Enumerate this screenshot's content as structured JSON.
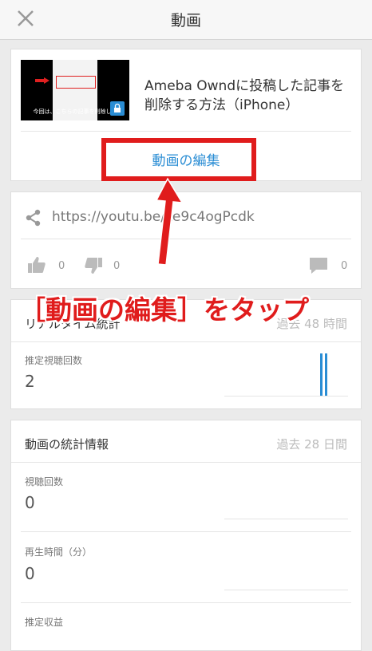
{
  "header": {
    "title": "動画",
    "close_icon": "close-icon"
  },
  "video": {
    "title": "Ameba Owndに投稿した記事を削除する方法（iPhone）",
    "thumbnail_caption": "今回は、こちらの記事を削除しま",
    "edit_label": "動画の編集"
  },
  "share": {
    "url": "https://youtu.be/ze9c4ogPcdk",
    "likes": "0",
    "dislikes": "0",
    "comments": "0"
  },
  "realtime": {
    "title": "リアルタイム統計",
    "period": "過去 48 時間",
    "metric_label": "推定視聴回数",
    "metric_value": "2"
  },
  "stats": {
    "title": "動画の統計情報",
    "period": "過去 28 日間",
    "views_label": "視聴回数",
    "views_value": "0",
    "watch_label": "再生時間（分）",
    "watch_value": "0",
    "revenue_label": "推定収益"
  },
  "annotation": {
    "text": "［動画の編集］をタップ",
    "color": "#e01c1c"
  },
  "colors": {
    "accent": "#2a8dd4",
    "annotation": "#e01c1c"
  }
}
